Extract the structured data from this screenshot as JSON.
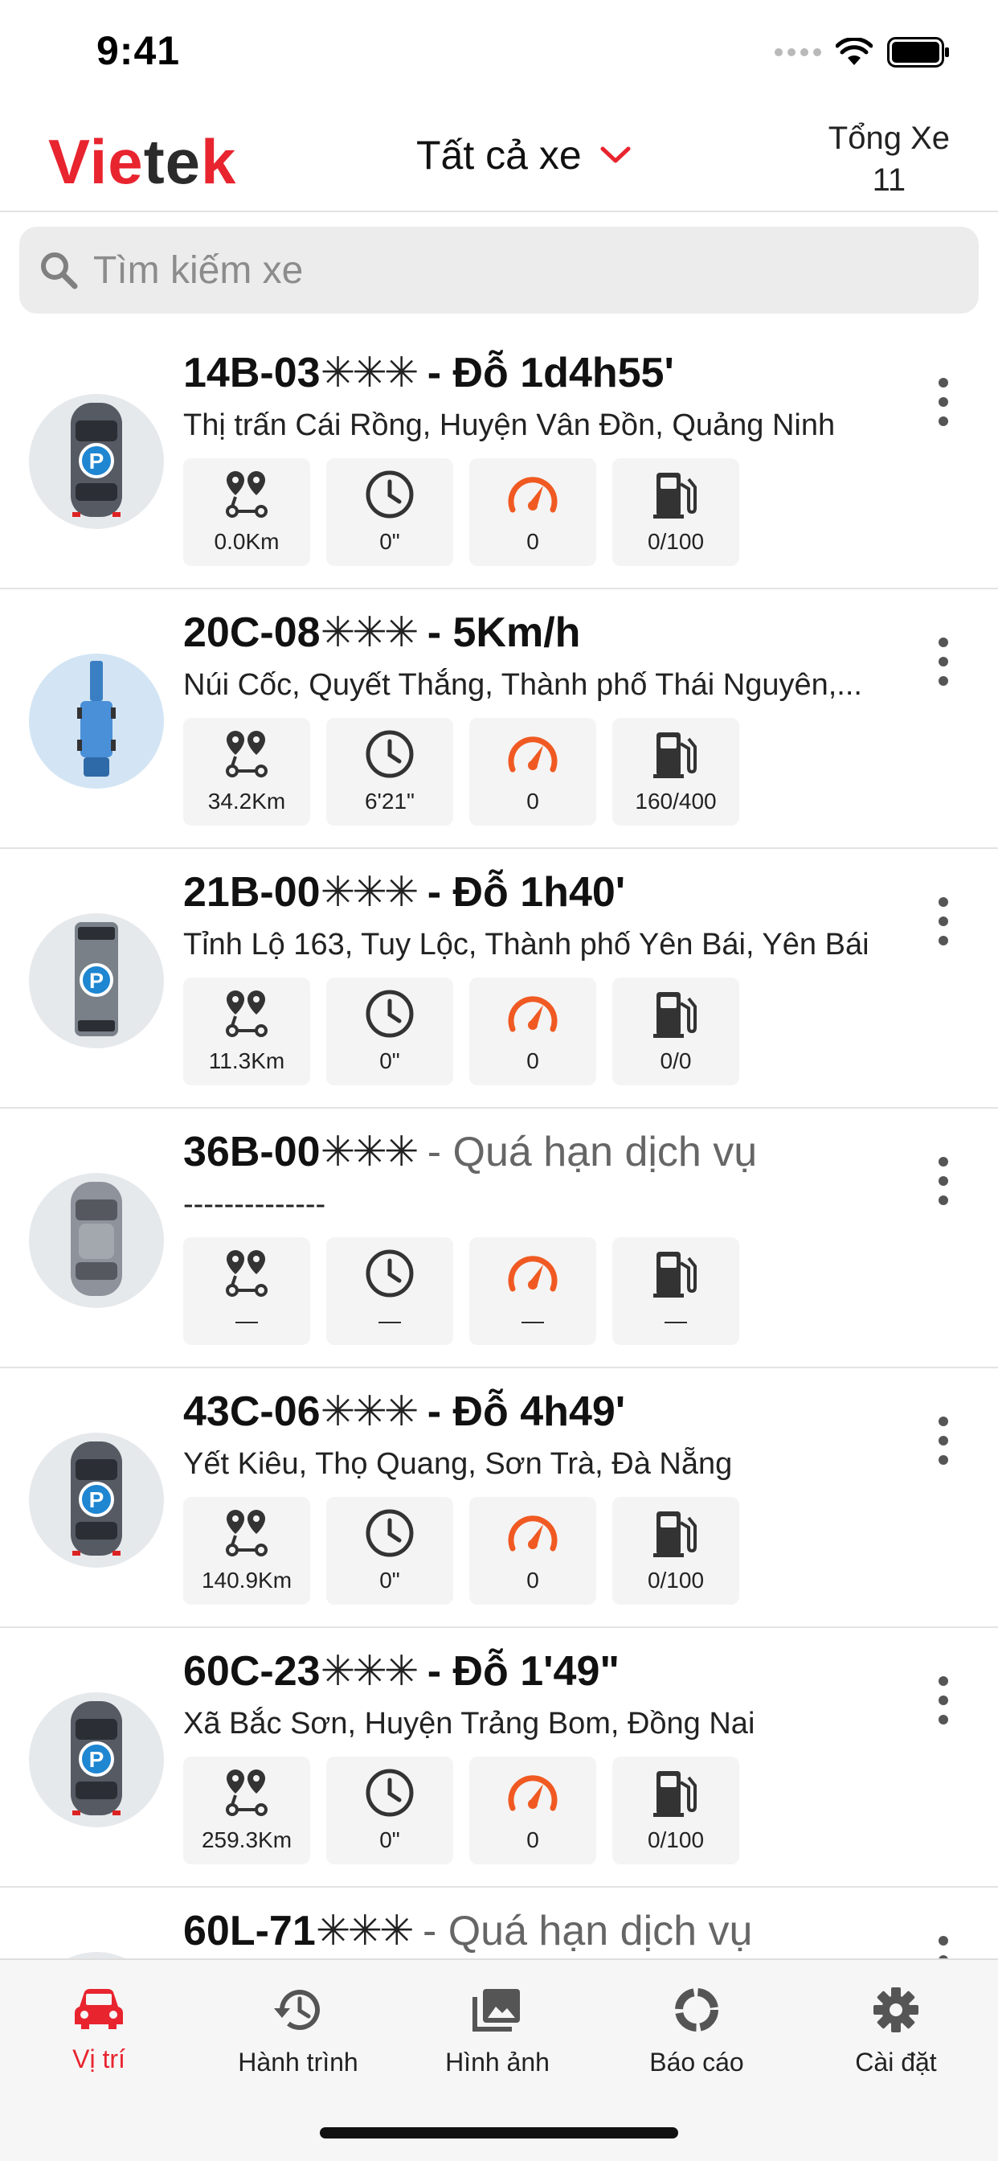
{
  "status_bar": {
    "time": "9:41"
  },
  "header": {
    "logo": {
      "part1": "Vi",
      "part2": "e",
      "part3": "te",
      "part4": "k"
    },
    "filter_label": "Tất cả xe",
    "total_label": "Tổng Xe",
    "total_count": "11"
  },
  "search": {
    "placeholder": "Tìm kiếm xe"
  },
  "colors": {
    "accent": "#e8242f",
    "speed_icon": "#f05a22",
    "icon_dark": "#333333"
  },
  "vehicles": [
    {
      "plate": "14B-03",
      "stars": "✳✳✳",
      "status": "- Đỗ 1d4h55'",
      "address": "Thị trấn Cái Rồng, Huyện Vân Đồn, Quảng Ninh",
      "distance": "0.0Km",
      "duration": "0\"",
      "speed": "0",
      "fuel": "0/100",
      "icon": "parked-car-icon"
    },
    {
      "plate": "20C-08",
      "stars": "✳✳✳",
      "status": "- 5Km/h",
      "address": "Núi Cốc, Quyết Thắng, Thành phố Thái Nguyên,...",
      "distance": "34.2Km",
      "duration": "6'21\"",
      "speed": "0",
      "fuel": "160/400",
      "icon": "blue-truck-icon"
    },
    {
      "plate": "21B-00",
      "stars": "✳✳✳",
      "status": "- Đỗ 1h40'",
      "address": "Tỉnh Lộ 163, Tuy Lộc, Thành phố Yên Bái, Yên Bái",
      "distance": "11.3Km",
      "duration": "0\"",
      "speed": "0",
      "fuel": "0/0",
      "icon": "parked-bus-icon"
    },
    {
      "plate": "36B-00",
      "stars": "✳✳✳",
      "status": "- Quá hạn dịch vụ",
      "address": "--------------",
      "distance": "—",
      "duration": "—",
      "speed": "—",
      "fuel": "—",
      "icon": "grey-car-icon"
    },
    {
      "plate": "43C-06",
      "stars": "✳✳✳",
      "status": "- Đỗ 4h49'",
      "address": "Yết Kiêu, Thọ Quang, Sơn Trà, Đà Nẵng",
      "distance": "140.9Km",
      "duration": "0\"",
      "speed": "0",
      "fuel": "0/100",
      "icon": "parked-car-icon"
    },
    {
      "plate": "60C-23",
      "stars": "✳✳✳",
      "status": "- Đỗ 1'49\"",
      "address": "Xã Bắc Sơn, Huyện Trảng Bom, Đồng Nai",
      "distance": "259.3Km",
      "duration": "0\"",
      "speed": "0",
      "fuel": "0/100",
      "icon": "parked-car-icon"
    },
    {
      "plate": "60L-71",
      "stars": "✳✳✳",
      "status": "- Quá hạn dịch vụ",
      "address": "",
      "distance": "",
      "duration": "",
      "speed": "",
      "fuel": "",
      "icon": "grey-car-icon"
    }
  ],
  "tabs": [
    {
      "label": "Vị trí",
      "icon": "car-icon",
      "active": true
    },
    {
      "label": "Hành trình",
      "icon": "history-icon",
      "active": false
    },
    {
      "label": "Hình ảnh",
      "icon": "images-icon",
      "active": false
    },
    {
      "label": "Báo cáo",
      "icon": "report-icon",
      "active": false
    },
    {
      "label": "Cài đặt",
      "icon": "gear-icon",
      "active": false
    }
  ]
}
